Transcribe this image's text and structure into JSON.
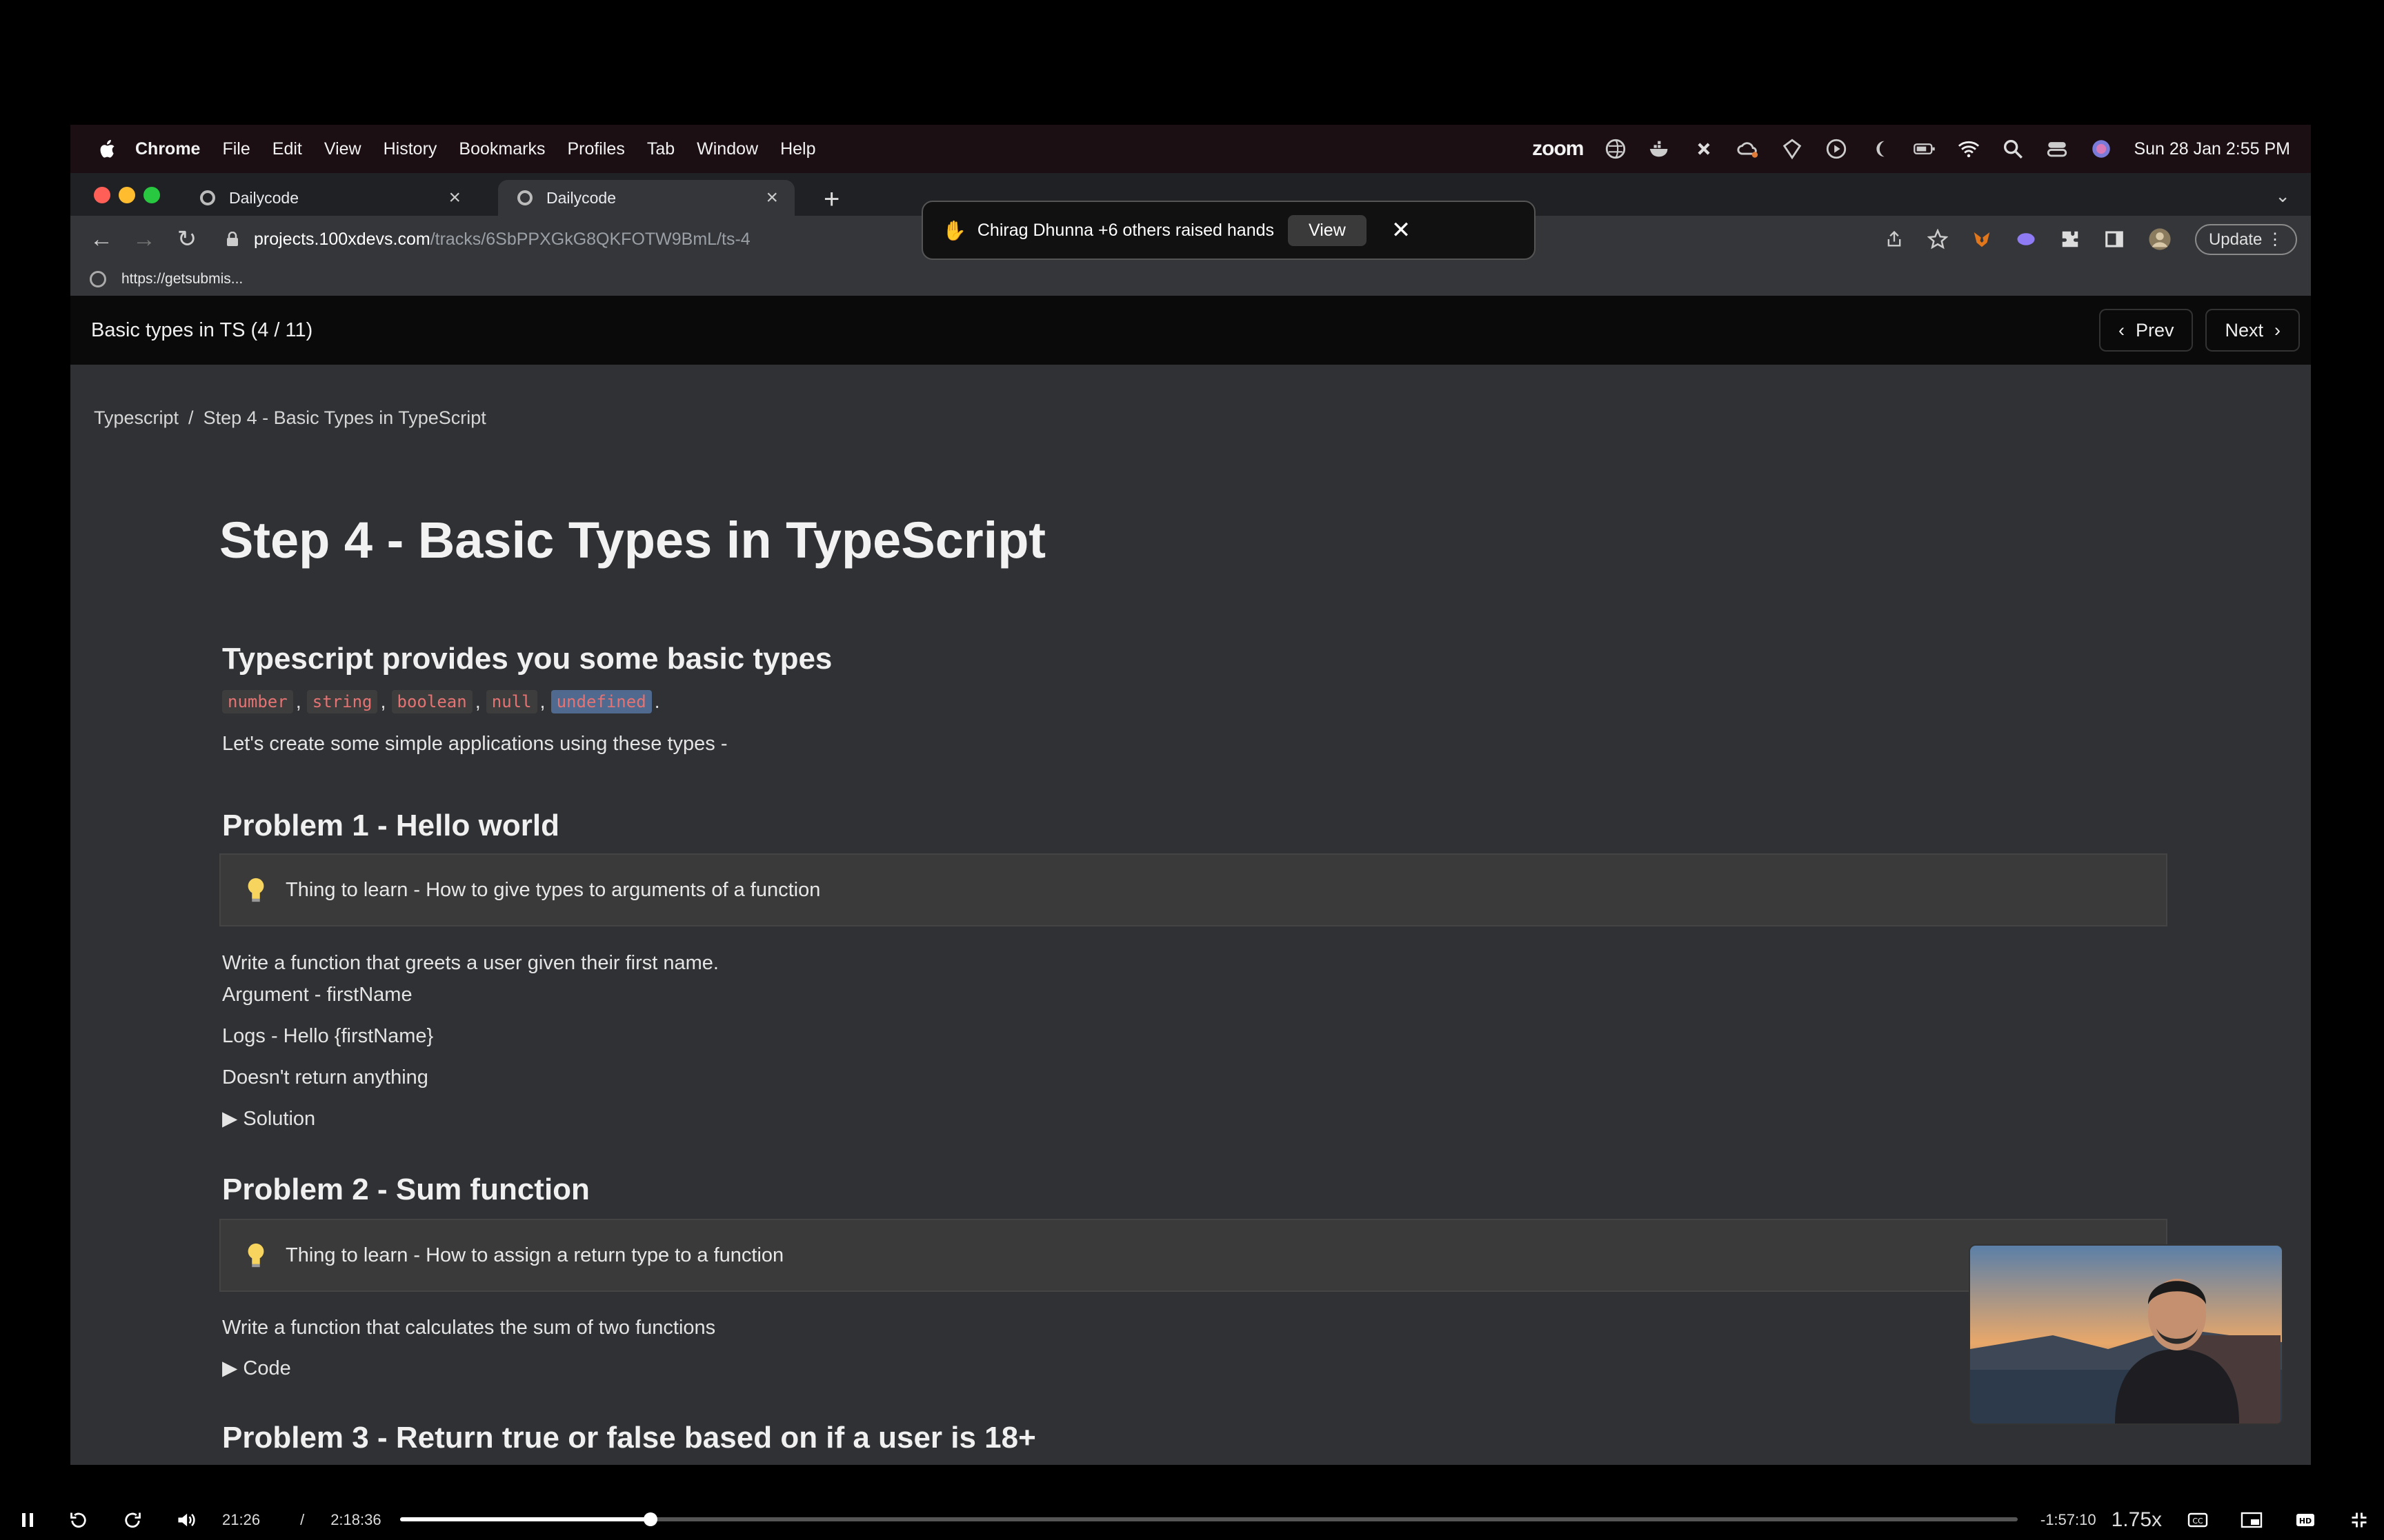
{
  "menubar": {
    "items": [
      "Chrome",
      "File",
      "Edit",
      "View",
      "History",
      "Bookmarks",
      "Profiles",
      "Tab",
      "Window",
      "Help"
    ],
    "zoom_label": "zoom",
    "datetime": "Sun 28 Jan  2:55 PM"
  },
  "tabs": [
    {
      "title": "Dailycode"
    },
    {
      "title": "Dailycode"
    }
  ],
  "address": {
    "host": "projects.100xdevs.com",
    "path": "/tracks/6SbPPXGkG8QKFOTW9BmL/ts-4",
    "update_label": "Update"
  },
  "bookmarks": {
    "item": "https://getsubmis..."
  },
  "notification": {
    "text": "Chirag Dhunna +6 others raised hands",
    "view_label": "View"
  },
  "page_header": {
    "title": "Basic types in TS (4 / 11)",
    "prev_label": "Prev",
    "next_label": "Next"
  },
  "breadcrumb": {
    "root": "Typescript",
    "sep": "/",
    "current": "Step 4 - Basic Types in TypeScript"
  },
  "article": {
    "title": "Step 4 - Basic Types in TypeScript",
    "intro_heading": "Typescript provides you some basic types",
    "types": [
      "number",
      "string",
      "boolean",
      "null",
      "undefined"
    ],
    "intro_text": "Let's create some simple applications using these types -",
    "p1": {
      "heading": "Problem 1 - Hello world",
      "callout": "Thing to learn - How to give types to arguments of a function",
      "lines": [
        "Write a function that greets a user given their first name.",
        "Argument - firstName",
        "Logs - Hello {firstName}",
        "Doesn't return anything"
      ],
      "details": "Solution"
    },
    "p2": {
      "heading": "Problem 2 - Sum function",
      "callout": "Thing to learn - How to assign a return type to a function",
      "line": "Write a function that calculates the sum of two functions",
      "details": "Code"
    },
    "p3": {
      "heading": "Problem 3 - Return true or false based on if a user is 18+"
    }
  },
  "player": {
    "elapsed": "21:26",
    "sep": "/",
    "duration": "2:18:36",
    "remaining": "-1:57:10",
    "speed": "1.75x",
    "progress": 0.155
  }
}
